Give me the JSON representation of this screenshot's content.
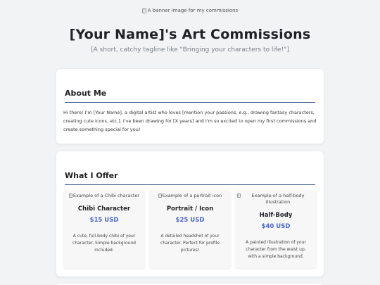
{
  "banner": {
    "alt": "A banner image for my commissions"
  },
  "header": {
    "title": "[Your Name]'s Art Commissions",
    "tagline": "[A short, catchy tagline like \"Bringing your characters to life!\"]"
  },
  "about": {
    "title": "About Me",
    "text": "Hi there! I'm [Your Name], a digital artist who loves [mention your passions, e.g., drawing fantasy characters, creating cute icons, etc.]. I've been drawing for [X years] and I'm so excited to open my first commissions and create something special for you!"
  },
  "offer": {
    "title": "What I Offer",
    "items": [
      {
        "image_alt": "Example of a Chibi character",
        "name": "Chibi Character",
        "price": "$15 USD",
        "description": "A cute, full-body chibi of your character. Simple background included."
      },
      {
        "image_alt": "Example of a portrait icon",
        "name": "Portrait / Icon",
        "price": "$25 USD",
        "description": "A detailed headshot of your character. Perfect for profile pictures!"
      },
      {
        "image_alt": "Example of a half-body illustration",
        "name": "Half-Body",
        "price": "$40 USD",
        "description": "A painted illustration of your character from the waist up, with a simple background."
      }
    ]
  },
  "colors": {
    "accent": "#4a67c7",
    "rule": "#3f5a8c",
    "background": "#f1f3f5"
  }
}
